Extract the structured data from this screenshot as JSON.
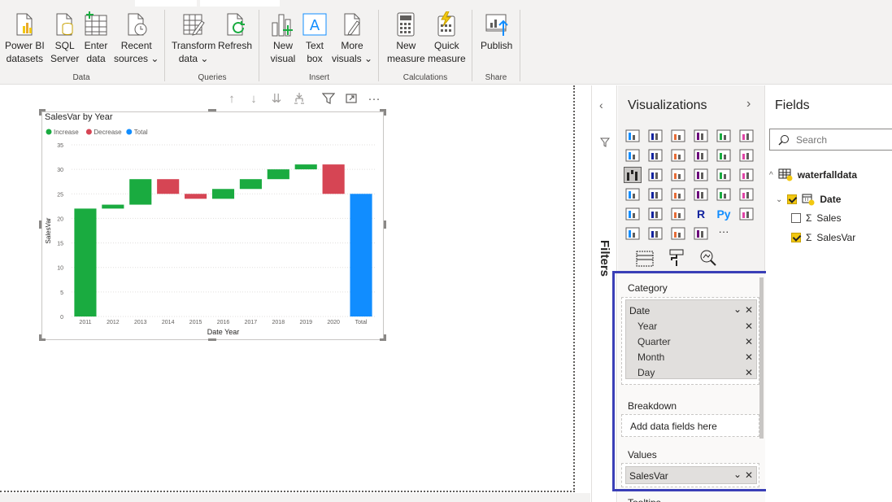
{
  "ribbon": {
    "buttons": [
      {
        "id": "power-bi-datasets",
        "l1": "Power BI",
        "l2": "datasets"
      },
      {
        "id": "sql-server",
        "l1": "SQL",
        "l2": "Server"
      },
      {
        "id": "enter-data",
        "l1": "Enter",
        "l2": "data"
      },
      {
        "id": "recent-sources",
        "l1": "Recent",
        "l2": "sources ⌄"
      },
      {
        "id": "transform-data",
        "l1": "Transform",
        "l2": "data ⌄"
      },
      {
        "id": "refresh",
        "l1": "Refresh",
        "l2": ""
      },
      {
        "id": "new-visual",
        "l1": "New",
        "l2": "visual"
      },
      {
        "id": "text-box",
        "l1": "Text",
        "l2": "box"
      },
      {
        "id": "more-visuals",
        "l1": "More",
        "l2": "visuals ⌄"
      },
      {
        "id": "new-measure",
        "l1": "New",
        "l2": "measure"
      },
      {
        "id": "quick-measure",
        "l1": "Quick",
        "l2": "measure"
      },
      {
        "id": "publish",
        "l1": "Publish",
        "l2": ""
      }
    ],
    "groups": {
      "data": "Data",
      "queries": "Queries",
      "insert": "Insert",
      "calculations": "Calculations",
      "share": "Share"
    }
  },
  "visual": {
    "more_options": "···"
  },
  "chart_data": {
    "type": "waterfall",
    "title": "SalesVar by Year",
    "xlabel": "Date Year",
    "ylabel": "SalesVar",
    "ylim": [
      0,
      35
    ],
    "yticks": [
      0,
      5,
      10,
      15,
      20,
      25,
      30,
      35
    ],
    "legend": [
      {
        "name": "Increase",
        "color": "#1aab40"
      },
      {
        "name": "Decrease",
        "color": "#d64554"
      },
      {
        "name": "Total",
        "color": "#118dff"
      }
    ],
    "categories": [
      "2011",
      "2012",
      "2013",
      "2014",
      "2015",
      "2016",
      "2017",
      "2018",
      "2019",
      "2020",
      "Total"
    ],
    "values": [
      22,
      0.8,
      5.2,
      -3,
      -1,
      2,
      2,
      2,
      1,
      -6,
      25
    ],
    "kinds": [
      "increase",
      "increase",
      "increase",
      "decrease",
      "decrease",
      "increase",
      "increase",
      "increase",
      "increase",
      "decrease",
      "total"
    ]
  },
  "filters": {
    "label": "Filters"
  },
  "visualizations": {
    "title": "Visualizations",
    "wells": {
      "category": {
        "label": "Category",
        "field": "Date",
        "items": [
          "Year",
          "Quarter",
          "Month",
          "Day"
        ]
      },
      "breakdown": {
        "label": "Breakdown",
        "placeholder": "Add data fields here"
      },
      "values": {
        "label": "Values",
        "field": "SalesVar"
      },
      "tooltips": {
        "label": "Tooltips"
      }
    }
  },
  "fields": {
    "title": "Fields",
    "search_placeholder": "Search",
    "table": "waterfalldata",
    "items": [
      {
        "name": "Date",
        "checked": true
      },
      {
        "name": "Sales",
        "checked": false
      },
      {
        "name": "SalesVar",
        "checked": true
      }
    ]
  }
}
